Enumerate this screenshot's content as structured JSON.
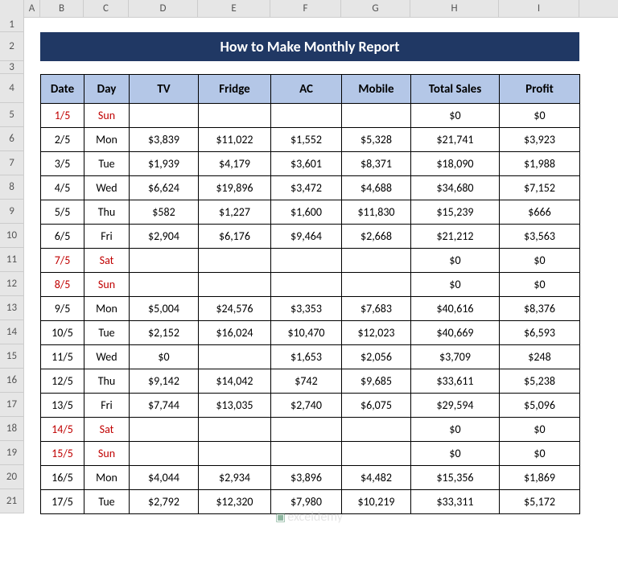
{
  "columns": [
    "A",
    "B",
    "C",
    "D",
    "E",
    "F",
    "G",
    "H",
    "I"
  ],
  "rowNumbers": [
    1,
    2,
    3,
    4,
    5,
    6,
    7,
    8,
    9,
    10,
    11,
    12,
    13,
    14,
    15,
    16,
    17,
    18,
    19,
    20,
    21
  ],
  "title": "How to Make Monthly Report",
  "headers": {
    "date": "Date",
    "day": "Day",
    "tv": "TV",
    "fridge": "Fridge",
    "ac": "AC",
    "mobile": "Mobile",
    "total": "Total Sales",
    "profit": "Profit"
  },
  "rows": [
    {
      "date": "1/5",
      "day": "Sun",
      "tv": "",
      "fridge": "",
      "ac": "",
      "mobile": "",
      "total": "$0",
      "profit": "$0",
      "weekend": true
    },
    {
      "date": "2/5",
      "day": "Mon",
      "tv": "$3,839",
      "fridge": "$11,022",
      "ac": "$1,552",
      "mobile": "$5,328",
      "total": "$21,741",
      "profit": "$3,923",
      "weekend": false
    },
    {
      "date": "3/5",
      "day": "Tue",
      "tv": "$1,939",
      "fridge": "$4,179",
      "ac": "$3,601",
      "mobile": "$8,371",
      "total": "$18,090",
      "profit": "$1,988",
      "weekend": false
    },
    {
      "date": "4/5",
      "day": "Wed",
      "tv": "$6,624",
      "fridge": "$19,896",
      "ac": "$3,472",
      "mobile": "$4,688",
      "total": "$34,680",
      "profit": "$7,152",
      "weekend": false
    },
    {
      "date": "5/5",
      "day": "Thu",
      "tv": "$582",
      "fridge": "$1,227",
      "ac": "$1,600",
      "mobile": "$11,830",
      "total": "$15,239",
      "profit": "$666",
      "weekend": false
    },
    {
      "date": "6/5",
      "day": "Fri",
      "tv": "$2,904",
      "fridge": "$6,176",
      "ac": "$9,464",
      "mobile": "$2,668",
      "total": "$21,212",
      "profit": "$3,563",
      "weekend": false
    },
    {
      "date": "7/5",
      "day": "Sat",
      "tv": "",
      "fridge": "",
      "ac": "",
      "mobile": "",
      "total": "$0",
      "profit": "$0",
      "weekend": true
    },
    {
      "date": "8/5",
      "day": "Sun",
      "tv": "",
      "fridge": "",
      "ac": "",
      "mobile": "",
      "total": "$0",
      "profit": "$0",
      "weekend": true
    },
    {
      "date": "9/5",
      "day": "Mon",
      "tv": "$5,004",
      "fridge": "$24,576",
      "ac": "$3,353",
      "mobile": "$7,683",
      "total": "$40,616",
      "profit": "$8,376",
      "weekend": false
    },
    {
      "date": "10/5",
      "day": "Tue",
      "tv": "$2,152",
      "fridge": "$16,024",
      "ac": "$10,470",
      "mobile": "$12,023",
      "total": "$40,669",
      "profit": "$6,593",
      "weekend": false
    },
    {
      "date": "11/5",
      "day": "Wed",
      "tv": "$0",
      "fridge": "",
      "ac": "$1,653",
      "mobile": "$2,056",
      "total": "$3,709",
      "profit": "$248",
      "weekend": false
    },
    {
      "date": "12/5",
      "day": "Thu",
      "tv": "$9,142",
      "fridge": "$14,042",
      "ac": "$742",
      "mobile": "$9,685",
      "total": "$33,611",
      "profit": "$5,238",
      "weekend": false
    },
    {
      "date": "13/5",
      "day": "Fri",
      "tv": "$7,744",
      "fridge": "$13,035",
      "ac": "$2,740",
      "mobile": "$6,075",
      "total": "$29,594",
      "profit": "$5,096",
      "weekend": false
    },
    {
      "date": "14/5",
      "day": "Sat",
      "tv": "",
      "fridge": "",
      "ac": "",
      "mobile": "",
      "total": "$0",
      "profit": "$0",
      "weekend": true
    },
    {
      "date": "15/5",
      "day": "Sun",
      "tv": "",
      "fridge": "",
      "ac": "",
      "mobile": "",
      "total": "$0",
      "profit": "$0",
      "weekend": true
    },
    {
      "date": "16/5",
      "day": "Mon",
      "tv": "$4,044",
      "fridge": "$2,934",
      "ac": "$3,896",
      "mobile": "$4,482",
      "total": "$15,356",
      "profit": "$1,869",
      "weekend": false
    },
    {
      "date": "17/5",
      "day": "Tue",
      "tv": "$2,792",
      "fridge": "$12,320",
      "ac": "$7,980",
      "mobile": "$10,219",
      "total": "$33,311",
      "profit": "$5,172",
      "weekend": false
    }
  ],
  "watermark": "exceldemy"
}
